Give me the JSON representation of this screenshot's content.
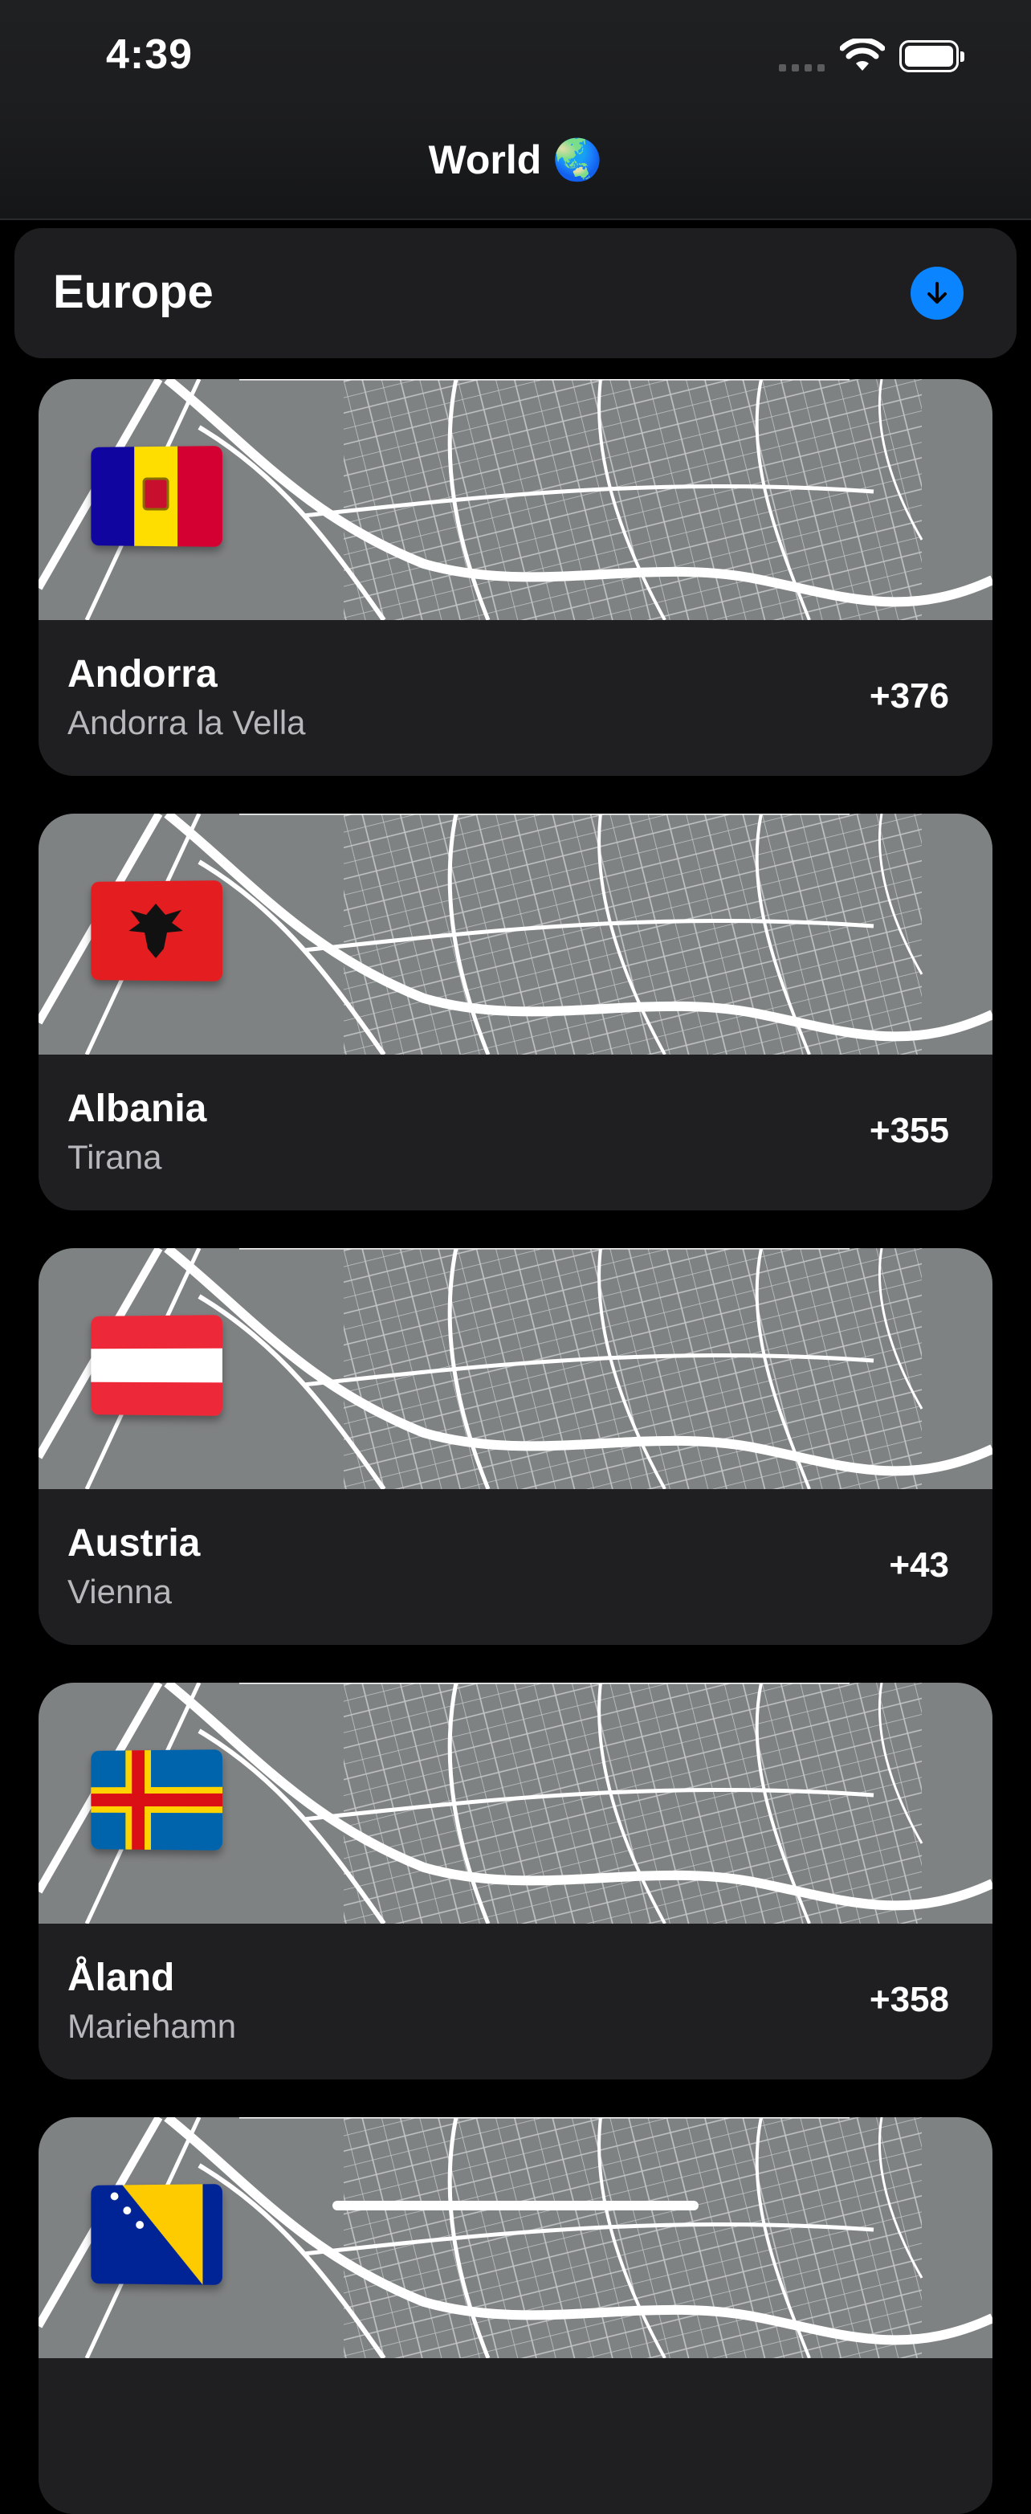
{
  "status_bar": {
    "time": "4:39"
  },
  "nav": {
    "title": "World 🌏"
  },
  "section": {
    "title": "Europe",
    "action_icon": "arrow-down-circle-icon",
    "accent": "#0a84ff"
  },
  "countries": [
    {
      "name": "Andorra",
      "capital": "Andorra la Vella",
      "dial_code": "+376",
      "flag": "andorra"
    },
    {
      "name": "Albania",
      "capital": "Tirana",
      "dial_code": "+355",
      "flag": "albania"
    },
    {
      "name": "Austria",
      "capital": "Vienna",
      "dial_code": "+43",
      "flag": "austria"
    },
    {
      "name": "Åland",
      "capital": "Mariehamn",
      "dial_code": "+358",
      "flag": "aland"
    },
    {
      "name": "",
      "capital": "",
      "dial_code": "",
      "flag": "bosnia"
    }
  ]
}
